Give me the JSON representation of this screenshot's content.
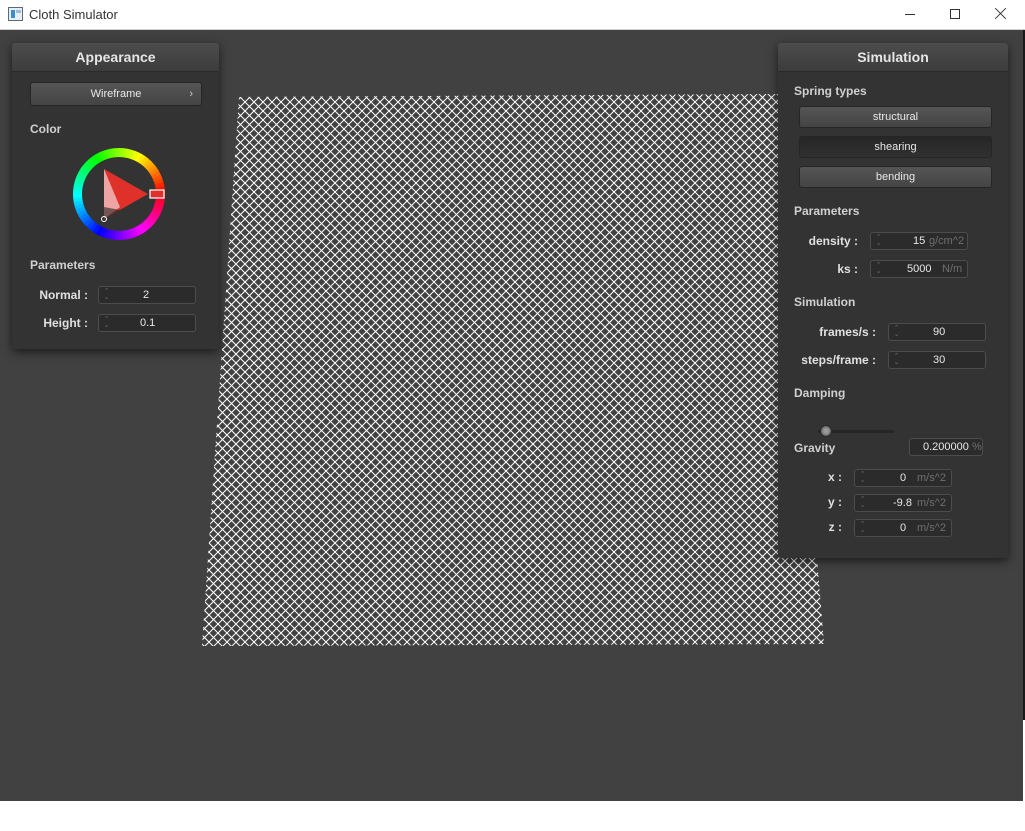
{
  "window": {
    "title": "Cloth Simulator"
  },
  "appearance_panel": {
    "title": "Appearance",
    "render_mode_button": "Wireframe",
    "render_mode_chevron": "›",
    "color_label": "Color",
    "parameters_label": "Parameters",
    "normal_label": "Normal :",
    "normal_value": "2",
    "height_label": "Height :",
    "height_value": "0.1",
    "selected_hue": "#e0302a"
  },
  "simulation_panel": {
    "title": "Simulation",
    "spring_types_label": "Spring types",
    "spring_buttons": [
      {
        "label": "structural",
        "pressed": false
      },
      {
        "label": "shearing",
        "pressed": true
      },
      {
        "label": "bending",
        "pressed": false
      }
    ],
    "parameters_label": "Parameters",
    "density_label": "density :",
    "density_value": "15",
    "density_unit": "g/cm^2",
    "ks_label": "ks :",
    "ks_value": "5000",
    "ks_unit": "N/m",
    "simulation_label": "Simulation",
    "fps_label": "frames/s :",
    "fps_value": "90",
    "steps_label": "steps/frame :",
    "steps_value": "30",
    "damping_label": "Damping",
    "damping_value": "0.200000",
    "damping_unit": "%",
    "damping_fraction": 0.002,
    "gravity_label": "Gravity",
    "gx_label": "x :",
    "gx_value": "0",
    "gy_label": "y :",
    "gy_value": "-9.8",
    "gz_label": "z :",
    "gz_value": "0",
    "gravity_unit": "m/s^2"
  },
  "colors": {
    "viewport_bg": "#414141",
    "cloth_line": "#ffffff",
    "panel_bg": "#333333"
  }
}
